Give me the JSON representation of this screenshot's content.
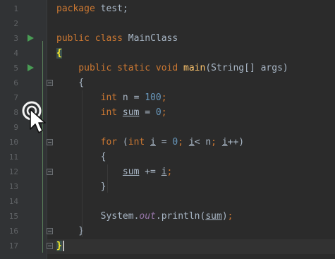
{
  "editor": {
    "line_numbers": [
      "1",
      "2",
      "3",
      "4",
      "5",
      "6",
      "7",
      "8",
      "9",
      "10",
      "11",
      "12",
      "13",
      "14",
      "15",
      "16",
      "17"
    ],
    "current_line": 17,
    "lines": [
      {
        "tokens": [
          {
            "t": "package ",
            "c": "kw"
          },
          {
            "t": "test;",
            "c": ""
          }
        ]
      },
      {
        "tokens": []
      },
      {
        "tokens": [
          {
            "t": "public ",
            "c": "kw"
          },
          {
            "t": "class ",
            "c": "kw"
          },
          {
            "t": "MainClass",
            "c": ""
          }
        ]
      },
      {
        "tokens": [
          {
            "t": "{",
            "c": "brace-hl"
          }
        ]
      },
      {
        "tokens": [
          {
            "t": "    public ",
            "c": "kw"
          },
          {
            "t": "static ",
            "c": "kw"
          },
          {
            "t": "void ",
            "c": "kw"
          },
          {
            "t": "main",
            "c": "fn"
          },
          {
            "t": "(String[] args)",
            "c": ""
          }
        ]
      },
      {
        "tokens": [
          {
            "t": "    {",
            "c": ""
          }
        ]
      },
      {
        "tokens": [
          {
            "t": "        int ",
            "c": "kw"
          },
          {
            "t": "n = ",
            "c": ""
          },
          {
            "t": "100",
            "c": "num"
          },
          {
            "t": ";",
            "c": "kw"
          }
        ]
      },
      {
        "tokens": [
          {
            "t": "        int ",
            "c": "kw"
          },
          {
            "t": "sum",
            "c": "ul"
          },
          {
            "t": " = ",
            "c": ""
          },
          {
            "t": "0",
            "c": "num"
          },
          {
            "t": ";",
            "c": "kw"
          }
        ]
      },
      {
        "tokens": []
      },
      {
        "tokens": [
          {
            "t": "        for ",
            "c": "kw"
          },
          {
            "t": "(",
            "c": ""
          },
          {
            "t": "int ",
            "c": "kw"
          },
          {
            "t": "i",
            "c": "ul"
          },
          {
            "t": " = ",
            "c": ""
          },
          {
            "t": "0",
            "c": "num"
          },
          {
            "t": "; ",
            "c": "kw"
          },
          {
            "t": "i",
            "c": "ul"
          },
          {
            "t": "< n",
            "c": ""
          },
          {
            "t": "; ",
            "c": "kw"
          },
          {
            "t": "i",
            "c": "ul"
          },
          {
            "t": "++)",
            "c": ""
          }
        ]
      },
      {
        "tokens": [
          {
            "t": "        {",
            "c": ""
          }
        ]
      },
      {
        "tokens": [
          {
            "t": "            ",
            "c": ""
          },
          {
            "t": "sum",
            "c": "ul"
          },
          {
            "t": " += ",
            "c": ""
          },
          {
            "t": "i",
            "c": "ul"
          },
          {
            "t": ";",
            "c": "kw"
          }
        ]
      },
      {
        "tokens": [
          {
            "t": "        }",
            "c": ""
          }
        ]
      },
      {
        "tokens": []
      },
      {
        "tokens": [
          {
            "t": "        System.",
            "c": ""
          },
          {
            "t": "out",
            "c": "field"
          },
          {
            "t": ".println(",
            "c": ""
          },
          {
            "t": "sum",
            "c": "ul"
          },
          {
            "t": ")",
            "c": ""
          },
          {
            "t": ";",
            "c": "kw"
          }
        ]
      },
      {
        "tokens": [
          {
            "t": "    }",
            "c": ""
          }
        ]
      },
      {
        "tokens": [
          {
            "t": "}",
            "c": "brace-hl"
          }
        ]
      }
    ]
  },
  "gutter": {
    "run_icon_name": "run-icon",
    "run_lines": [
      3,
      5
    ],
    "fold_open_lines": [
      6,
      10
    ],
    "fold_close_lines": [
      12,
      16,
      17
    ]
  },
  "colors": {
    "background": "#2b2b2b",
    "gutter": "#313335",
    "keyword": "#cc7832",
    "function": "#ffc66d",
    "number": "#6897bb",
    "field": "#9876aa",
    "text": "#a9b7c6",
    "run_icon": "#499c54"
  },
  "cursor": {
    "icon": "mouse-pointer-icon"
  }
}
